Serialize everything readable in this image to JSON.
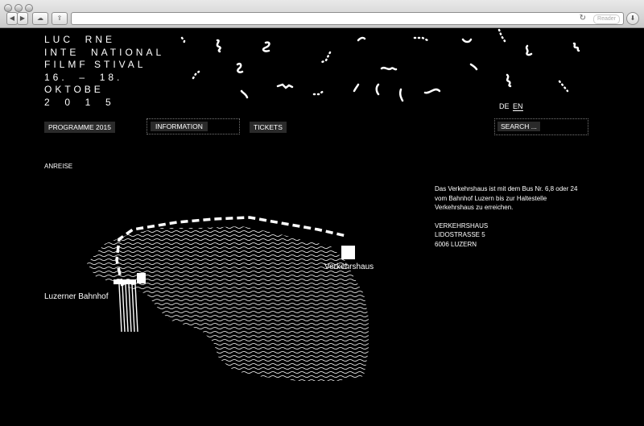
{
  "browser": {
    "reader_label": "Reader"
  },
  "logo": {
    "lines": [
      "LUC  RNE",
      "INTE  NATIONAL",
      "FILMF STIVAL",
      "16.  –  18.",
      "OKTOBE",
      "2  0  1  5"
    ]
  },
  "lang": {
    "de": "DE",
    "en": "EN"
  },
  "nav": {
    "programme": "PROGRAMME 2015",
    "information": "INFORMATION",
    "tickets": "TICKETS",
    "search": "SEARCH ..."
  },
  "section": {
    "title": "ANREISE"
  },
  "info": {
    "description": "Das Verkehrshaus ist mit dem Bus Nr. 6,8 oder 24 vom Bahnhof Luzern bis zur Haltestelle Verkehrshaus zu erreichen.",
    "address_name": "VERKEHRSHAUS",
    "address_street": "LIDOSTRASSE 5",
    "address_city": "6006 LUZERN"
  },
  "map": {
    "label_verkehrshaus": "Verkehrshaus",
    "label_bahnhof": "Luzerner Bahnhof"
  }
}
